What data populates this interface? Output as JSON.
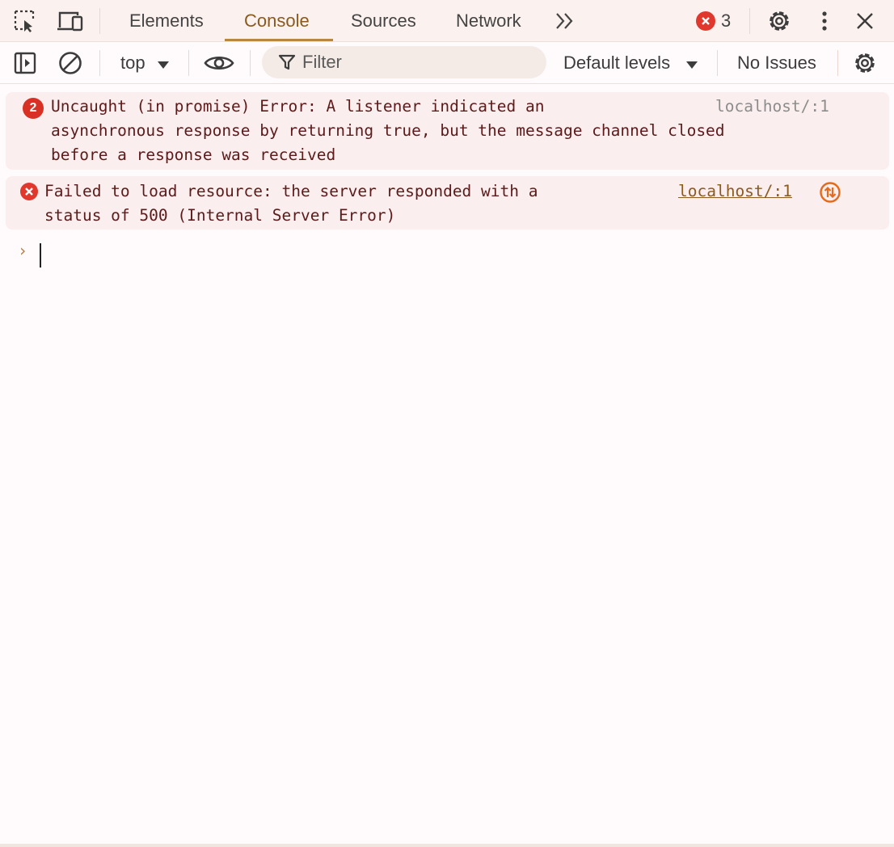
{
  "tabbar": {
    "tabs": [
      {
        "label": "Elements",
        "active": false
      },
      {
        "label": "Console",
        "active": true
      },
      {
        "label": "Sources",
        "active": false
      },
      {
        "label": "Network",
        "active": false
      }
    ],
    "more_tabs_glyph": "»",
    "error_count": "3",
    "icons": [
      "inspect-element-icon",
      "device-toolbar-icon",
      "more-tabs-icon",
      "error-icon",
      "settings-icon",
      "kebab-menu-icon",
      "close-icon"
    ]
  },
  "toolbar": {
    "context": "top",
    "filter_placeholder": "Filter",
    "levels": "Default levels",
    "issues": "No Issues",
    "icons": [
      "sidebar-toggle-icon",
      "clear-console-icon",
      "chevron-down-icon",
      "eye-icon",
      "filter-icon",
      "settings-icon"
    ]
  },
  "messages": [
    {
      "count": "2",
      "lines": [
        "Uncaught (in promise) Error: A listener indicated an",
        "asynchronous response by returning true, but the message channel closed",
        "before a response was received"
      ],
      "source": "localhost/:1"
    },
    {
      "lines": [
        "Failed to load resource: the server responded with a",
        "status of 500 (Internal Server Error)"
      ],
      "source": "localhost/:1",
      "network_icon": "network-request-icon"
    }
  ],
  "prompt": {
    "glyph": "›"
  },
  "colors": {
    "error_red": "#d93025",
    "accent": "#b58740",
    "link_brown": "#8a5a1f",
    "message_bg": "#fbeeee"
  }
}
